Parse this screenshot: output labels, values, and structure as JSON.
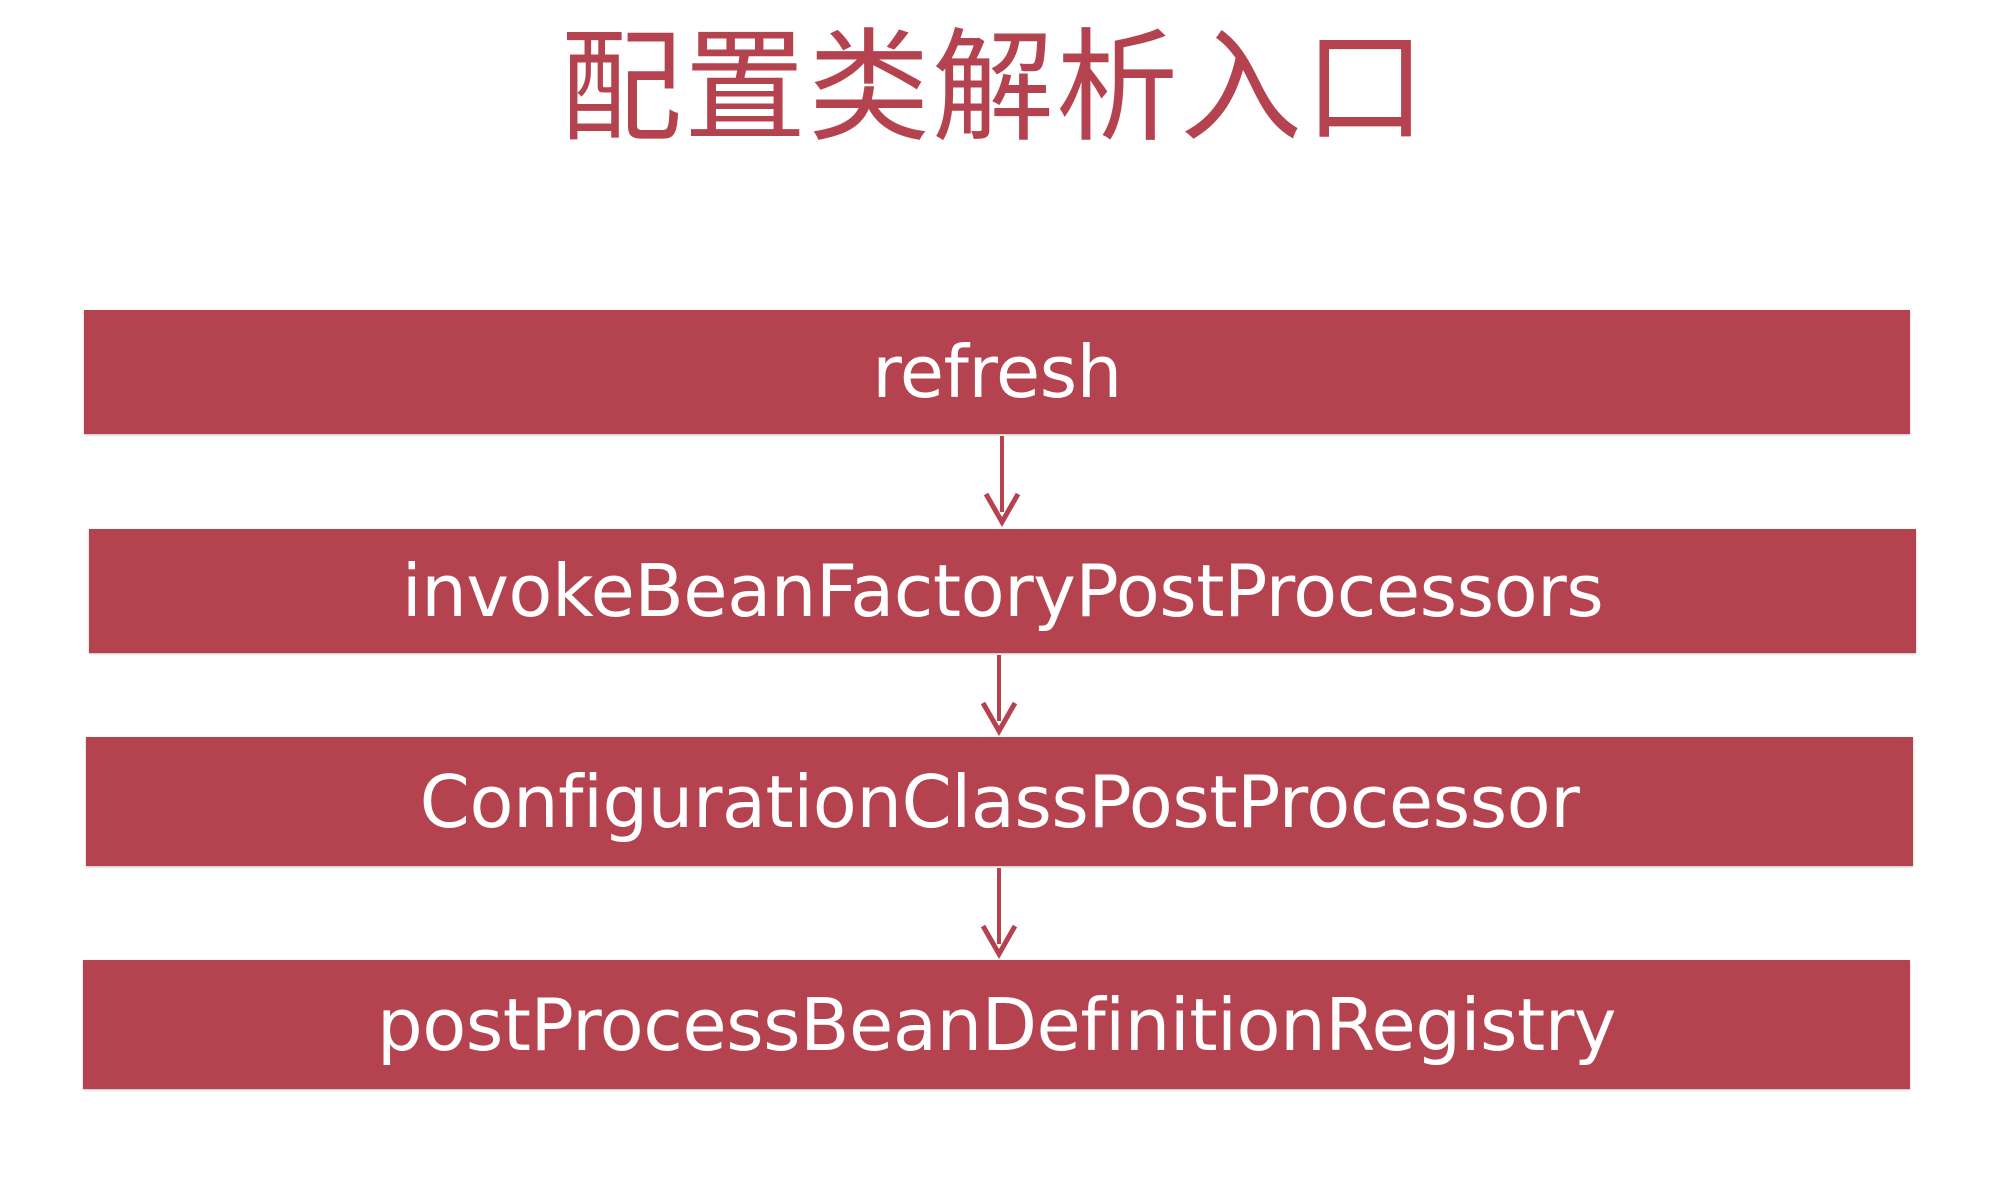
{
  "title": "配置类解析入口",
  "colors": {
    "accent": "#b5434f",
    "box_text": "#ffffff",
    "background": "#ffffff"
  },
  "flow": {
    "steps": [
      {
        "label": "refresh"
      },
      {
        "label": "invokeBeanFactoryPostProcessors"
      },
      {
        "label": "ConfigurationClassPostProcessor"
      },
      {
        "label": "postProcessBeanDefinitionRegistry"
      }
    ],
    "connector": "arrow-down"
  }
}
